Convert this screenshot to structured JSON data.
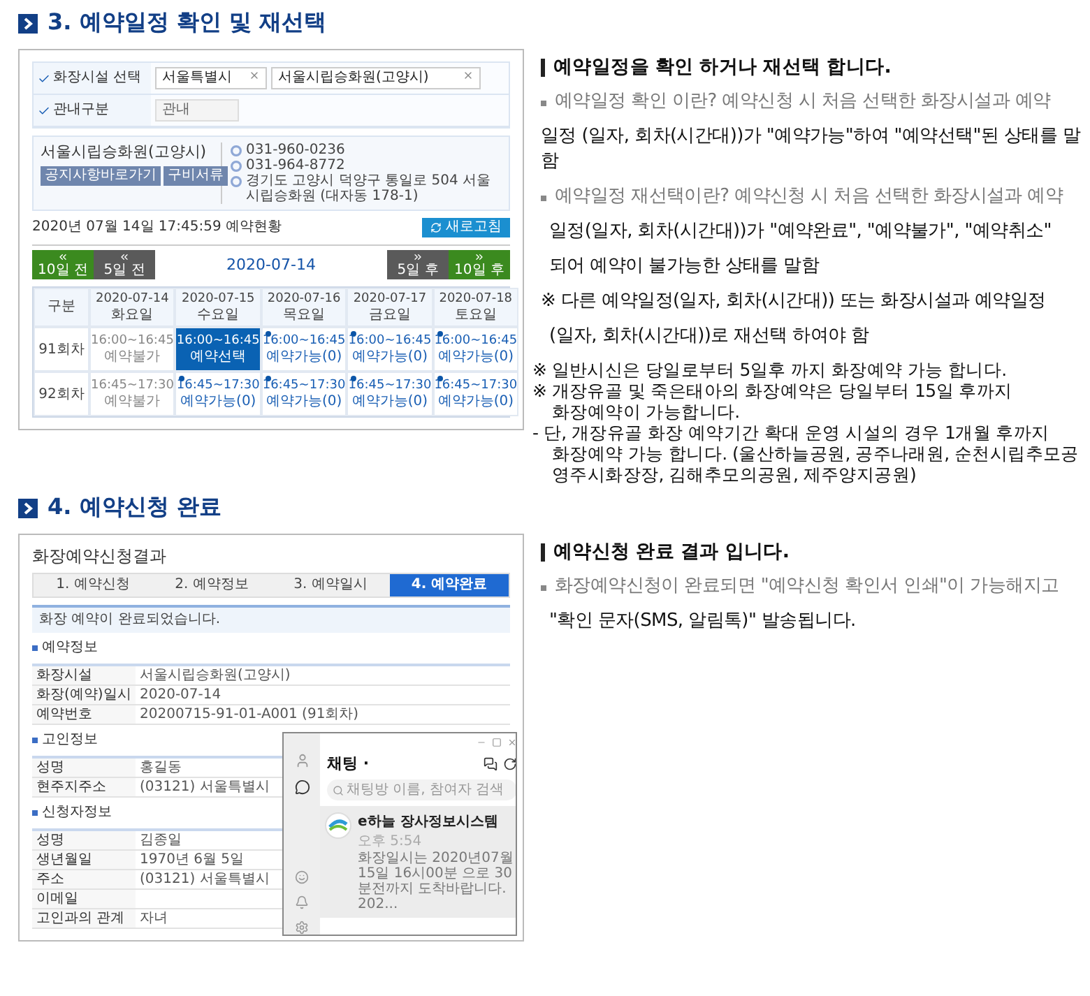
{
  "sections": [
    {
      "title": "3. 예약일정 확인 및 재선택",
      "schedule_screen": {
        "form": [
          {
            "label": "화장시설 선택",
            "fields": [
              {
                "kind": "select",
                "value": "서울특별시"
              },
              {
                "kind": "select",
                "value": "서울시립승화원(고양시)"
              }
            ]
          },
          {
            "label": "관내구분",
            "fields": [
              {
                "kind": "input",
                "value": "관내"
              }
            ]
          }
        ],
        "facility": {
          "name": "서울시립승화원(고양시)",
          "buttons": [
            "공지사항바로가기",
            "구비서류"
          ],
          "contacts": [
            "031-960-0236",
            "031-964-8772",
            "경기도 고양시 덕양구 통일로 504 서울시립승화원 (대자동 178-1)"
          ]
        },
        "status": "2020년 07월 14일 17:45:59 예약현황",
        "refresh": "새로고침",
        "prev": [
          {
            "label": "10일 전",
            "color": "#3b8a1f"
          },
          {
            "label": "5일 전",
            "color": "#5a5a5a"
          }
        ],
        "date": "2020-07-14",
        "next": [
          {
            "label": "5일 후",
            "color": "#5a5a5a"
          },
          {
            "label": "10일 후",
            "color": "#3b8a1f"
          }
        ],
        "corner": "구분",
        "columns": [
          {
            "date": "2020-07-14",
            "day": "화요일"
          },
          {
            "date": "2020-07-15",
            "day": "수요일"
          },
          {
            "date": "2020-07-16",
            "day": "목요일"
          },
          {
            "date": "2020-07-17",
            "day": "금요일"
          },
          {
            "date": "2020-07-18",
            "day": "토요일"
          }
        ],
        "rows": [
          {
            "label": "91회차",
            "cells": [
              {
                "kind": "closed",
                "time": "16:00~16:45",
                "status": "예약불가",
                "selected": false
              },
              {
                "kind": "open",
                "time": "16:00~16:45",
                "status": "예약선택",
                "selected": true
              },
              {
                "kind": "open",
                "time": "16:00~16:45",
                "status": "예약가능(0)",
                "selected": false
              },
              {
                "kind": "open",
                "time": "16:00~16:45",
                "status": "예약가능(0)",
                "selected": false
              },
              {
                "kind": "open",
                "time": "16:00~16:45",
                "status": "예약가능(0)",
                "selected": false
              }
            ]
          },
          {
            "label": "92회차",
            "cells": [
              {
                "kind": "closed",
                "time": "16:45~17:30",
                "status": "예약불가",
                "selected": false
              },
              {
                "kind": "open",
                "time": "16:45~17:30",
                "status": "예약가능(0)",
                "selected": false
              },
              {
                "kind": "open",
                "time": "16:45~17:30",
                "status": "예약가능(0)",
                "selected": false
              },
              {
                "kind": "open",
                "time": "16:45~17:30",
                "status": "예약가능(0)",
                "selected": false
              },
              {
                "kind": "open",
                "time": "16:45~17:30",
                "status": "예약가능(0)",
                "selected": false
              }
            ]
          }
        ]
      },
      "notes": [
        {
          "kind": "heading",
          "text": "예약일정을 확인 하거나 재선택 합니다."
        },
        {
          "kind": "bullet",
          "text": "예약일정 확인 이란? 예약신청 시 처음 선택한 화장시설과 예약"
        },
        {
          "kind": "plain",
          "text": "일정 (일자, 회차(시간대))가 \"예약가능\"하여 \"예약선택\"된 상태를 말함"
        },
        {
          "kind": "bullet",
          "text": "예약일정 재선택이란? 예약신청 시 처음 선택한 화장시설과 예약"
        },
        {
          "kind": "indent",
          "text": "일정(일자, 회차(시간대))가 \"예약완료\", \"예약불가\", \"예약취소\""
        },
        {
          "kind": "indent",
          "text": "되어 예약이 불가능한 상태를 말함"
        },
        {
          "kind": "plain",
          "text": "※ 다른 예약일정(일자, 회차(시간대)) 또는 화장시설과 예약일정"
        },
        {
          "kind": "indent",
          "text": "(일자, 회차(시간대))로 재선택 하여야 함"
        },
        {
          "kind": "note",
          "text": "※ 일반시신은 당일로부터 5일후 까지 화장예약 가능 합니다."
        },
        {
          "kind": "note",
          "text": "※ 개장유골 및 죽은태아의 화장예약은 당일부터 15일 후까지"
        },
        {
          "kind": "note-indent",
          "text": "화장예약이 가능합니다."
        },
        {
          "kind": "note",
          "text": "- 단, 개장유골 화장 예약기간 확대 운영 시설의 경우 1개월 후까지"
        },
        {
          "kind": "note-indent",
          "text": "화장예약 가능 합니다. (울산하늘공원, 공주나래원, 순천시립추모공"
        },
        {
          "kind": "note-indent",
          "text": "영주시화장장, 김해추모의공원, 제주양지공원)"
        }
      ]
    },
    {
      "title": "4. 예약신청 완료",
      "result_screen": {
        "title": "화장예약신청결과",
        "steps": [
          {
            "label": "1. 예약신청",
            "selected": false
          },
          {
            "label": "2. 예약정보",
            "selected": false
          },
          {
            "label": "3. 예약일시",
            "selected": false
          },
          {
            "label": "4. 예약완료",
            "selected": true
          }
        ],
        "message": "화장 예약이 완료되었습니다.",
        "groups": [
          {
            "title": "예약정보",
            "rows": [
              {
                "label": "화장시설",
                "value": "서울시립승화원(고양시)"
              },
              {
                "label": "화장(예약)일시",
                "value": "2020-07-14"
              },
              {
                "label": "예약번호",
                "value": "20200715-91-01-A001 (91회차)"
              }
            ]
          },
          {
            "title": "고인정보",
            "rows": [
              {
                "label": "성명",
                "value": "홍길동"
              },
              {
                "label": "현주지주소",
                "value": "(03121) 서울특별시"
              }
            ]
          },
          {
            "title": "신청자정보",
            "rows": [
              {
                "label": "성명",
                "value": "김종일"
              },
              {
                "label": "생년월일",
                "value": "1970년 6월 5일"
              },
              {
                "label": "주소",
                "value": "(03121) 서울특별시"
              },
              {
                "label": "이메일"
              },
              {
                "label": "고인과의 관계",
                "value": "자녀"
              }
            ]
          }
        ],
        "chat": {
          "title": "채팅 ·",
          "placeholder": "채팅방 이름, 참여자 검색",
          "items": [
            {
              "name": "e하늘 장사정보시스템",
              "time": "오후 5:54",
              "preview": "화장일시는 2020년07월15일 16시00분 으로 30분전까지 도착바랍니다. 202...",
              "selected": true
            }
          ]
        }
      },
      "notes": [
        {
          "kind": "heading",
          "text": "예약신청 완료 결과 입니다."
        },
        {
          "kind": "bullet",
          "text": "화장예약신청이 완료되면 \"예약신청 확인서 인쇄\"이 가능해지고"
        },
        {
          "kind": "indent",
          "text": "\"확인 문자(SMS, 알림톡)\" 발송됩니다."
        }
      ]
    }
  ]
}
